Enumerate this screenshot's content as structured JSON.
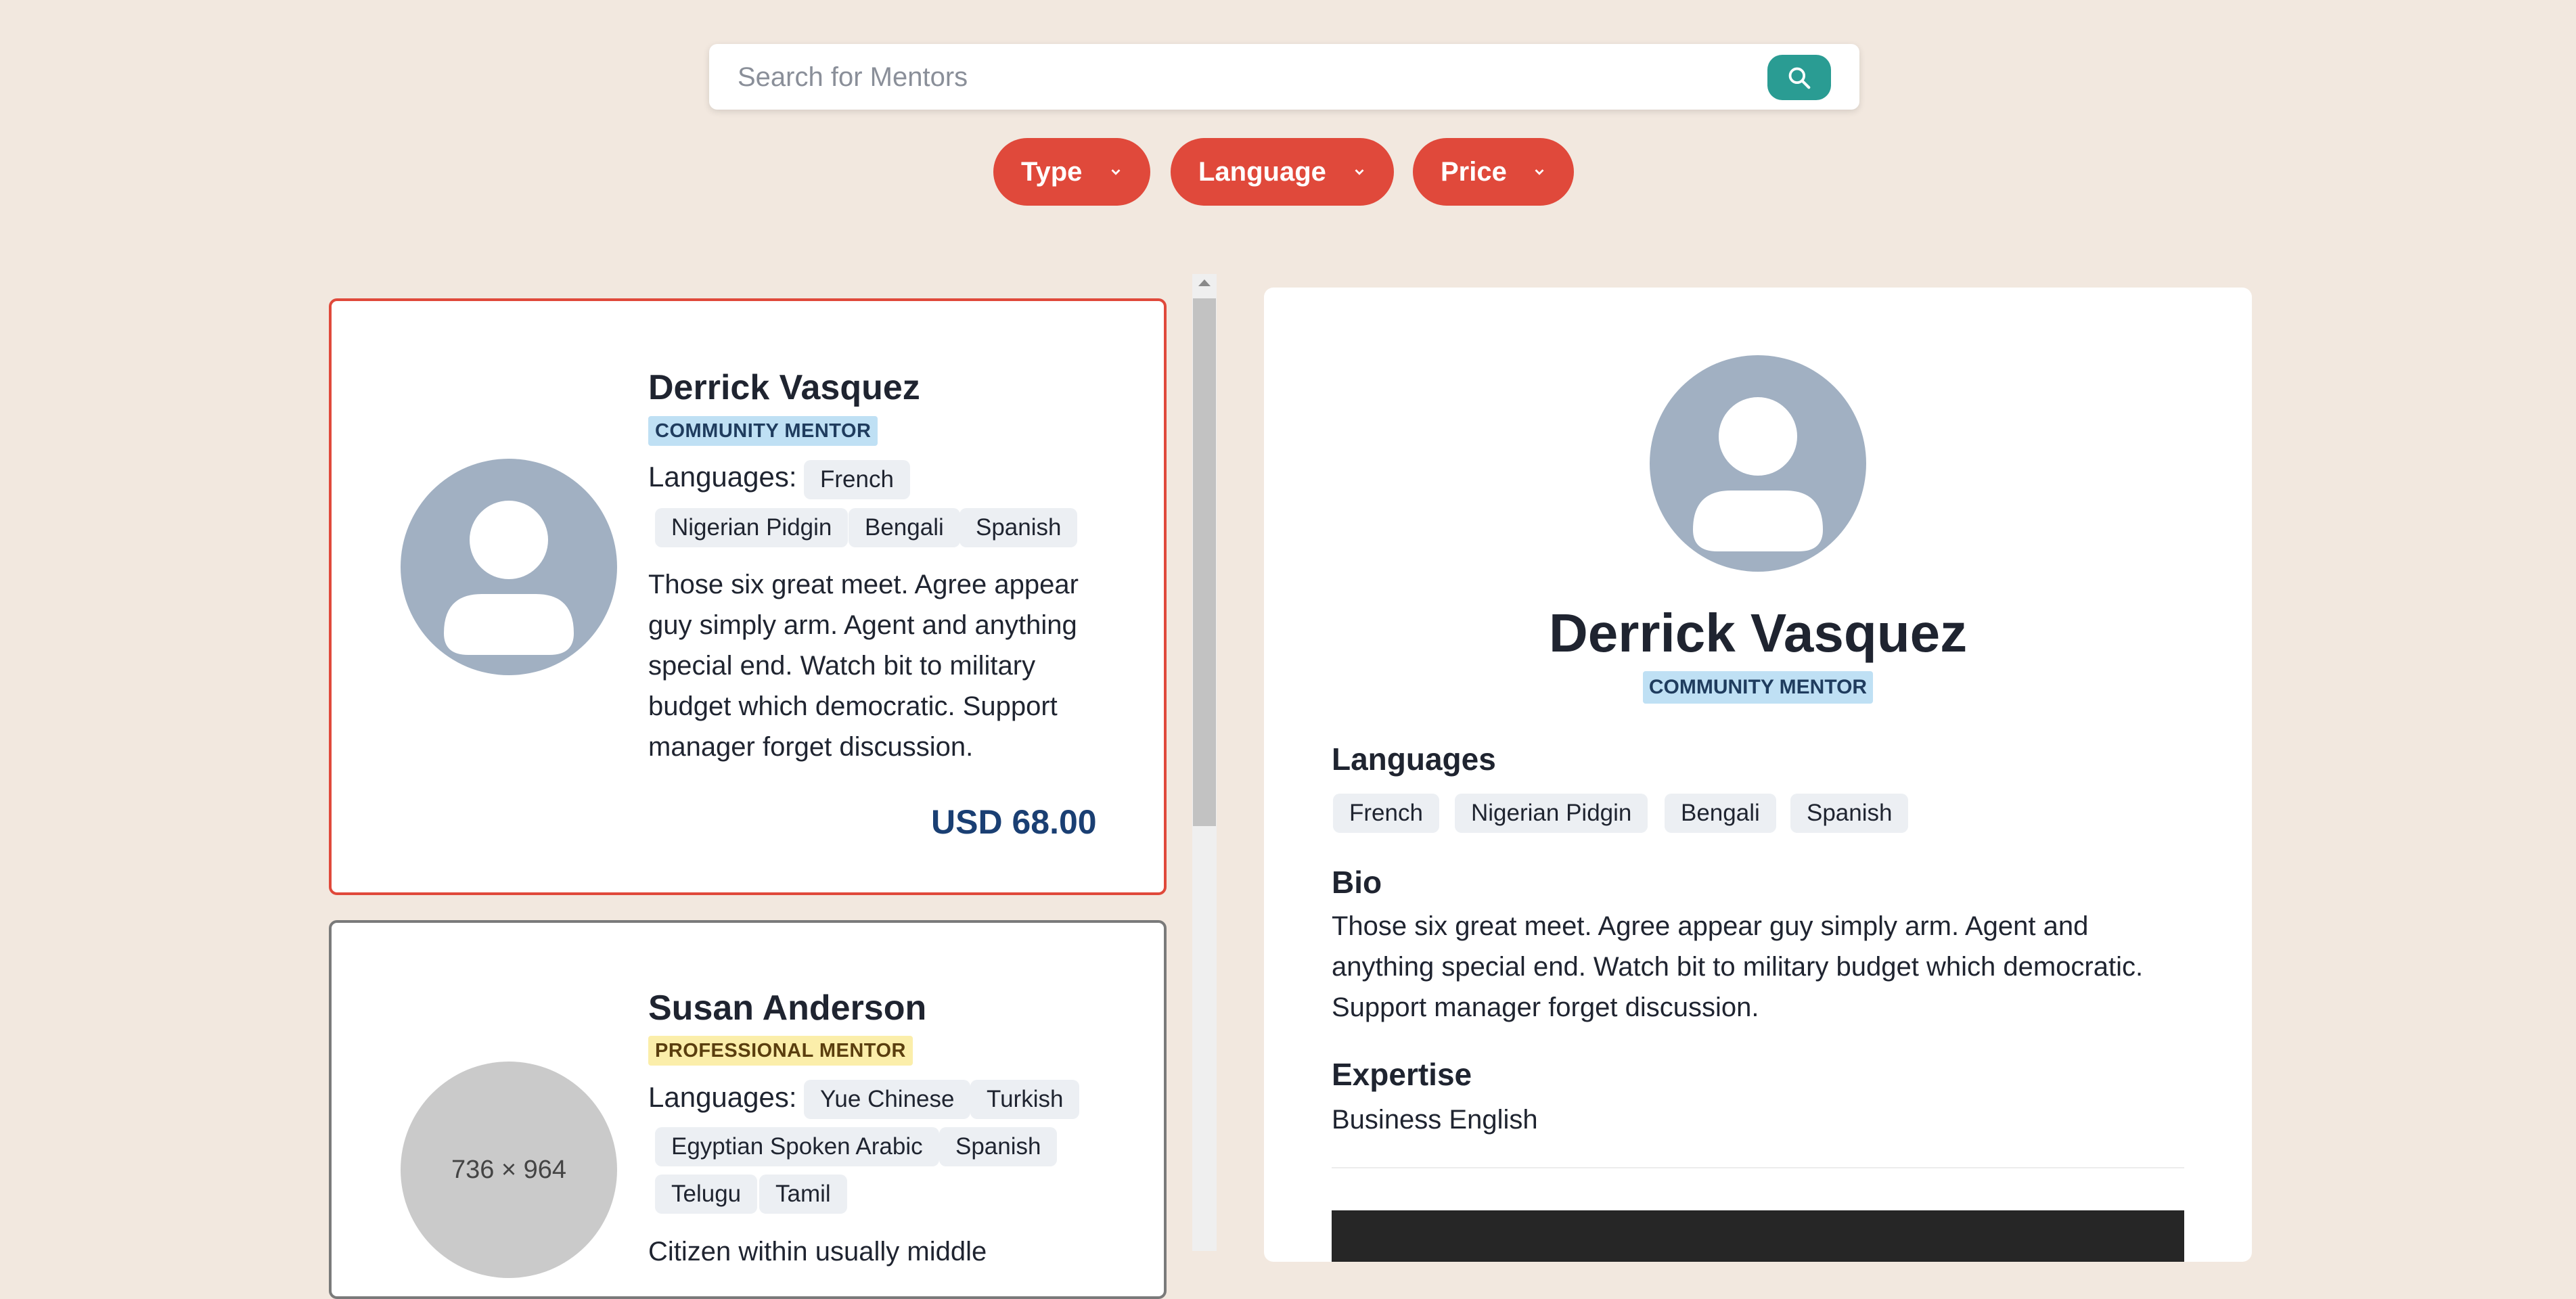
{
  "search": {
    "placeholder": "Search for Mentors",
    "button_icon": "search-icon"
  },
  "filters": [
    {
      "label": "Type",
      "icon": "chevron-down-icon"
    },
    {
      "label": "Language",
      "icon": "chevron-down-icon"
    },
    {
      "label": "Price",
      "icon": "chevron-down-icon"
    }
  ],
  "mentors": [
    {
      "name": "Derrick Vasquez",
      "badge": "COMMUNITY MENTOR",
      "languages_label": "Languages:",
      "languages": [
        "French",
        "Nigerian Pidgin",
        "Bengali",
        "Spanish"
      ],
      "bio_lines": [
        "Those six great meet. Agree appear",
        "guy simply arm. Agent and anything",
        "special end. Watch bit to military",
        "budget which democratic. Support",
        "manager forget discussion."
      ],
      "price": "USD 68.00",
      "avatar": "user-avatar-icon",
      "selected": true
    },
    {
      "name": "Susan Anderson",
      "badge": "PROFESSIONAL MENTOR",
      "languages_label": "Languages:",
      "languages": [
        "Yue Chinese",
        "Turkish",
        "Egyptian Spoken Arabic",
        "Spanish",
        "Telugu",
        "Tamil"
      ],
      "bio_first_line": "Citizen within usually middle",
      "avatar_placeholder": "736 × 964"
    }
  ],
  "detail": {
    "name": "Derrick Vasquez",
    "badge": "COMMUNITY MENTOR",
    "languages_heading": "Languages",
    "languages": [
      "French",
      "Nigerian Pidgin",
      "Bengali",
      "Spanish"
    ],
    "bio_heading": "Bio",
    "bio_lines": [
      "Those six great meet. Agree appear guy simply arm. Agent and",
      "anything special end. Watch bit to military budget which democratic.",
      "Support manager forget discussion."
    ],
    "expertise_heading": "Expertise",
    "expertise": "Business English"
  },
  "colors": {
    "background": "#f2e8df",
    "filter": "#e0493b",
    "search_button": "#2a9c93",
    "price": "#1a3f73",
    "avatar": "#a1b0c2"
  }
}
